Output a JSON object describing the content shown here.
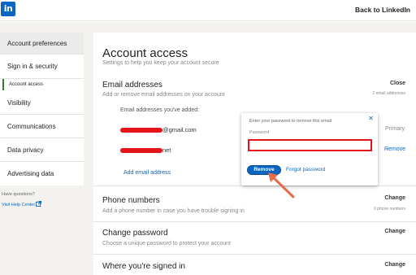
{
  "header": {
    "logo_text": "in",
    "back_label": "Back to LinkedIn"
  },
  "sidebar": {
    "items": [
      {
        "label": "Account preferences"
      },
      {
        "label": "Sign in & security"
      },
      {
        "label": "Visibility"
      },
      {
        "label": "Communications"
      },
      {
        "label": "Data privacy"
      },
      {
        "label": "Advertising data"
      }
    ],
    "sub_item": "Account access",
    "help_text": "Have questions?",
    "help_link": "Visit Help Center"
  },
  "main": {
    "title": "Account access",
    "subtitle": "Settings to help you keep your account secure",
    "email": {
      "title": "Email addresses",
      "description": "Add or remove email addresses on your account",
      "action": "Close",
      "meta": "2 email addresses",
      "added_label": "Email addresses you've added:",
      "emails": [
        {
          "visible_suffix": "@gmail.com",
          "status": "Primary"
        },
        {
          "visible_suffix": "net",
          "status": "Remove"
        }
      ],
      "add_label": "Add email address"
    },
    "phone": {
      "title": "Phone numbers",
      "description": "Add a phone number in case you have trouble signing in",
      "action": "Change",
      "meta": "0 phone numbers"
    },
    "password": {
      "title": "Change password",
      "description": "Choose a unique password to protect your account",
      "action": "Change"
    },
    "signed_in": {
      "title": "Where you're signed in",
      "action": "Change"
    }
  },
  "popup": {
    "instruction": "Enter your password to remove this email",
    "password_label": "Password",
    "password_value": "",
    "remove_label": "Remove",
    "forgot_label": "Forgot password"
  },
  "colors": {
    "brand": "#0a66c2",
    "highlight": "#e3141a",
    "arrow": "#e86b4a",
    "active_indicator": "#2e7d32"
  }
}
